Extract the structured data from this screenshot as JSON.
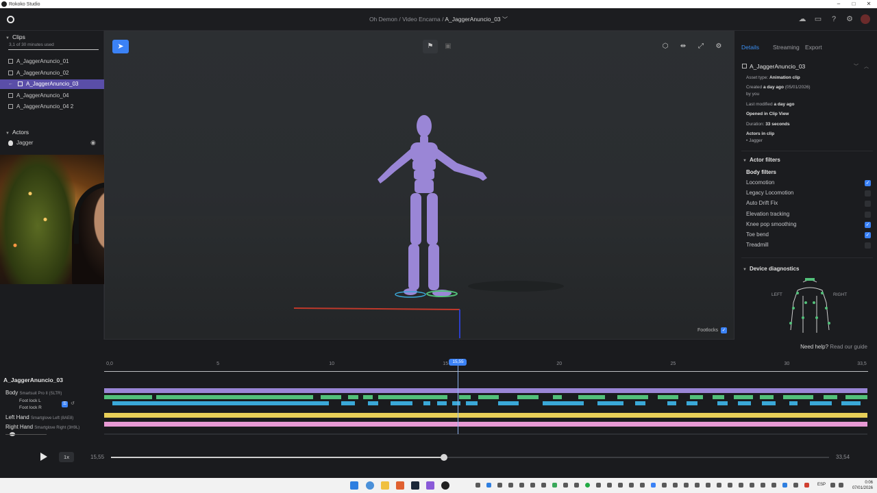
{
  "window": {
    "title": "Rokoko Studio",
    "controls": [
      "–",
      "□",
      "✕"
    ]
  },
  "header": {
    "breadcrumb": [
      "Oh Demon",
      "Video Encarna",
      "A_JaggerAnuncio_03"
    ],
    "separator": " / ",
    "icons": [
      "cloud-icon",
      "headset-icon",
      "help-icon",
      "settings-icon",
      "avatar"
    ]
  },
  "clips": {
    "title": "Clips",
    "usage": "3,1 of 30 minutes used",
    "items": [
      "A_JaggerAnuncio_01",
      "A_JaggerAnuncio_02",
      "A_JaggerAnuncio_03",
      "A_JaggerAnuncio_04",
      "A_JaggerAnuncio_04 2"
    ],
    "selected_index": 2
  },
  "actors": {
    "title": "Actors",
    "items": [
      "Jagger"
    ]
  },
  "viewport": {
    "footlocks_label": "Footlocks",
    "footlocks_checked": true,
    "accent": "#3b82f6",
    "character_color": "#9a86d6"
  },
  "details": {
    "tabs": [
      "Details",
      "Streaming",
      "Export"
    ],
    "active_tab": "Details",
    "asset_name": "A_JaggerAnuncio_03",
    "asset_type_label": "Asset type:",
    "asset_type": "Animation clip",
    "created_label": "Created",
    "created_value": "a day ago",
    "created_date": "(05/01/2026)",
    "created_by": "by you",
    "modified_label": "Last modified",
    "modified_value": "a day ago",
    "opened_label": "Opened in Clip View",
    "duration_label": "Duration:",
    "duration_value": "33 seconds",
    "actors_in_clip_label": "Actors in clip",
    "actors_in_clip": "• Jagger"
  },
  "actor_filters": {
    "title": "Actor filters",
    "group": "Body filters",
    "items": [
      {
        "label": "Locomotion",
        "checked": true
      },
      {
        "label": "Legacy Locomotion",
        "checked": false
      },
      {
        "label": "Auto Drift Fix",
        "checked": false
      },
      {
        "label": "Elevation tracking",
        "checked": false
      },
      {
        "label": "Knee pop smoothing",
        "checked": true
      },
      {
        "label": "Toe bend",
        "checked": true
      },
      {
        "label": "Treadmill",
        "checked": false
      }
    ]
  },
  "diagnostics": {
    "title": "Device diagnostics",
    "left": "LEFT",
    "right": "RIGHT"
  },
  "timeline": {
    "help_text": "Need help?",
    "help_link": "Read our guide",
    "clip_title": "A_JaggerAnuncio_03",
    "start_label": "0,0",
    "end_label": "33,5",
    "ticks": [
      "5",
      "10",
      "15",
      "20",
      "25",
      "30"
    ],
    "playhead_label": "15,55",
    "duration_seconds": 33.54,
    "playhead_seconds": 15.55,
    "tracks": [
      {
        "name": "Body",
        "device": "Smartsuit Pro II (SLTR)",
        "color": "#9a86d6"
      },
      {
        "name": "Left Hand",
        "device": "Smartglove Left (8AE8)",
        "color": "#e8cf58"
      },
      {
        "name": "Right Hand",
        "device": "Smartglove Right (3H9L)",
        "color": "#e79ad4"
      }
    ],
    "subtracks": [
      "Foot lock L",
      "Foot lock R"
    ],
    "foot_color_l": "#52c07a",
    "foot_color_r": "#3aa8d8"
  },
  "transport": {
    "speed": "1x",
    "time_current": "15,55",
    "time_total": "33,54",
    "progress": 0.4637
  },
  "taskbar": {
    "lang": "ESP",
    "time": "0:06",
    "date": "07/01/2026"
  }
}
